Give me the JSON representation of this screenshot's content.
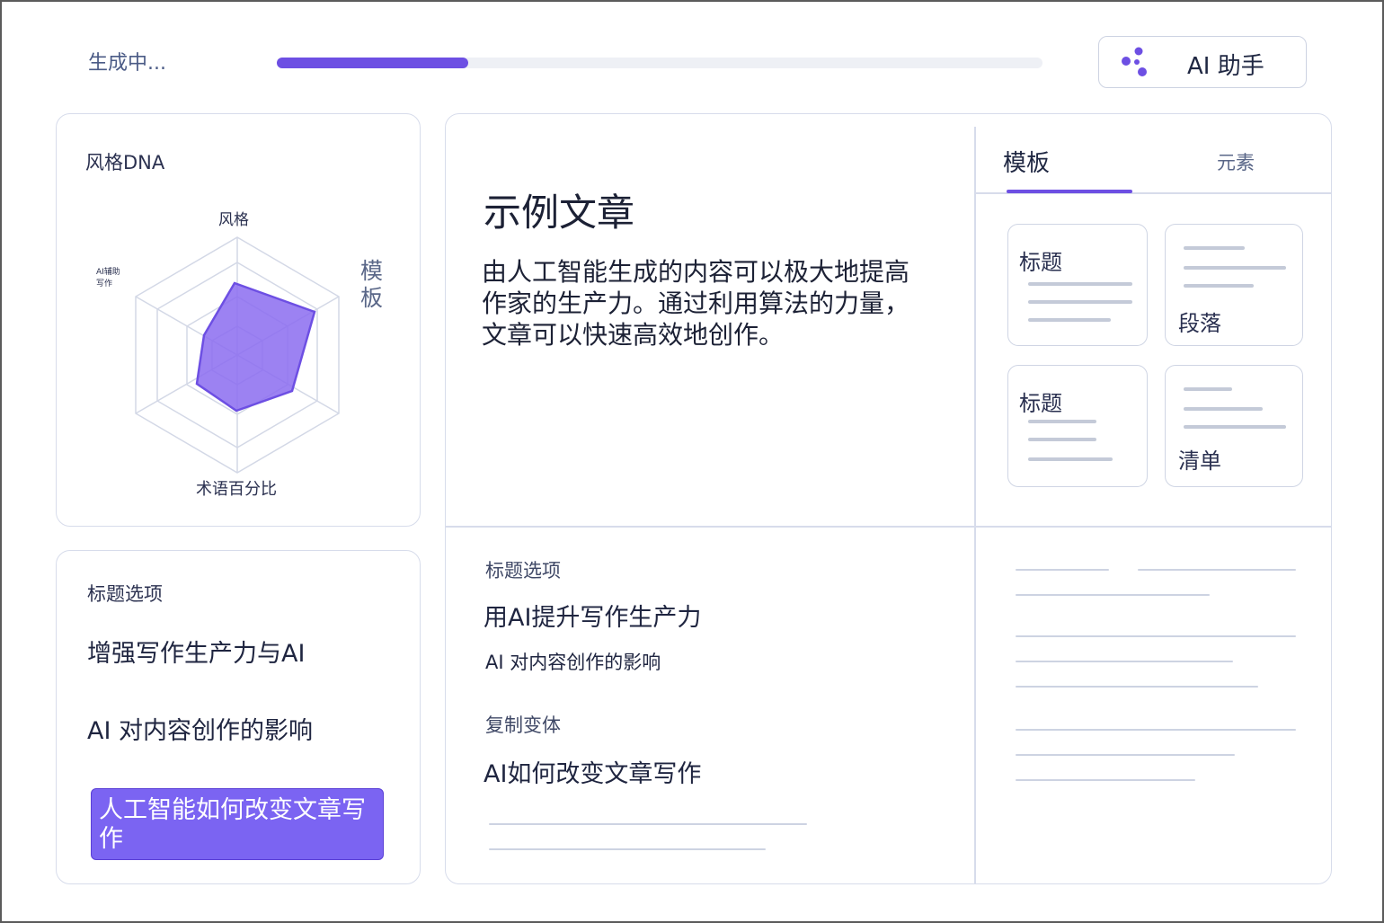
{
  "header": {
    "status": "生成中...",
    "progress": 0.25,
    "ai_button_label": "AI 助手",
    "ai_icon": "molecule-icon",
    "accent": "#6d4fe3"
  },
  "style_dna": {
    "title": "风格DNA",
    "axes": {
      "top": "风格",
      "right": "模板",
      "bottom": "术语百分比",
      "left": "AI辅助写作"
    }
  },
  "titles_panel": {
    "heading": "标题选项",
    "options": [
      "增强写作生产力与AI",
      "AI 对内容创作的影响",
      "人工智能如何改变文章写作"
    ],
    "selected_index": 2
  },
  "article": {
    "title": "示例文章",
    "body": "由人工智能生成的内容可以极大地提高作家的生产力。通过利用算法的力量，文章可以快速高效地创作。"
  },
  "template_panel": {
    "tabs": [
      "模板",
      "元素"
    ],
    "active_tab": 0,
    "cards": [
      "标题",
      "段落",
      "标题",
      "清单"
    ]
  },
  "options_panel": {
    "heading1": "标题选项",
    "option_a": "用AI提升写作生产力",
    "option_b": "AI 对内容创作的影响",
    "heading2": "复制变体",
    "option_c": "AI如何改变文章写作"
  }
}
